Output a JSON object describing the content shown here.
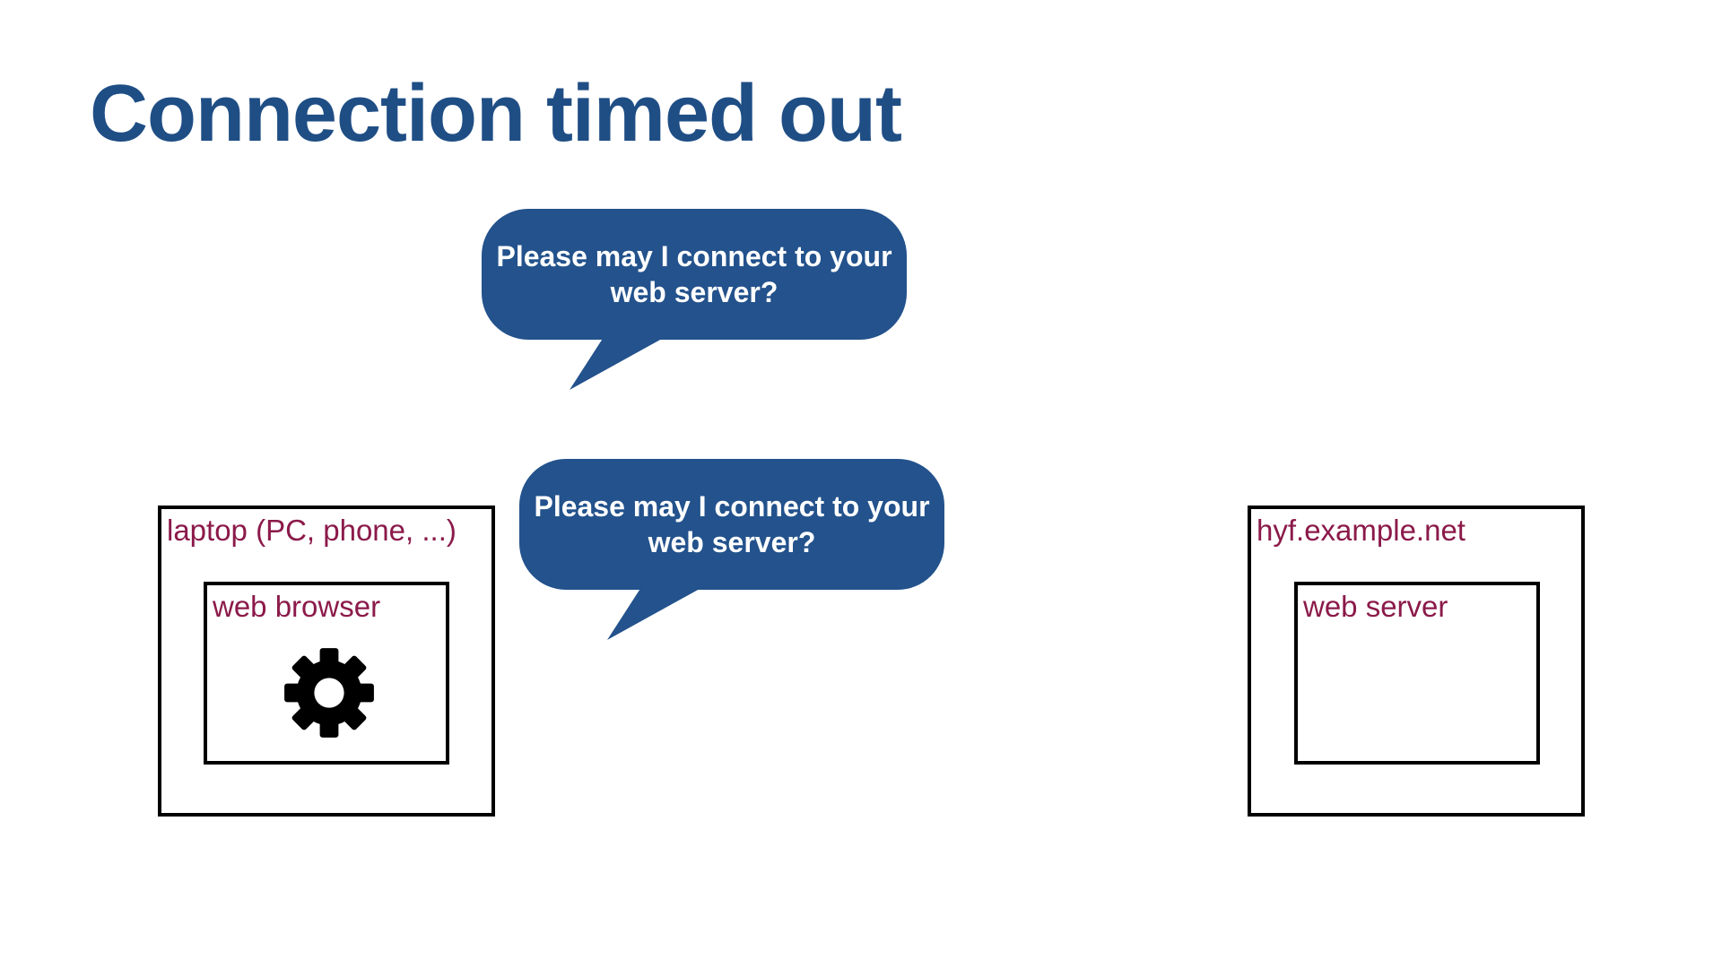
{
  "slide": {
    "title": "Connection timed out"
  },
  "bubbles": [
    {
      "line1": "Please may I connect to your",
      "line2": "web server?"
    },
    {
      "line1": "Please may I connect to your",
      "line2": "web server?"
    }
  ],
  "client": {
    "outer_label": "laptop (PC, phone, ...)",
    "inner_label": "web browser",
    "icon": "gear-icon"
  },
  "server": {
    "outer_label": "hyf.example.net",
    "inner_label": "web server"
  },
  "colors": {
    "title": "#1f4e85",
    "bubble_fill": "#23528c",
    "label": "#8b1a4a",
    "box_border": "#000000",
    "gear": "#000000"
  }
}
